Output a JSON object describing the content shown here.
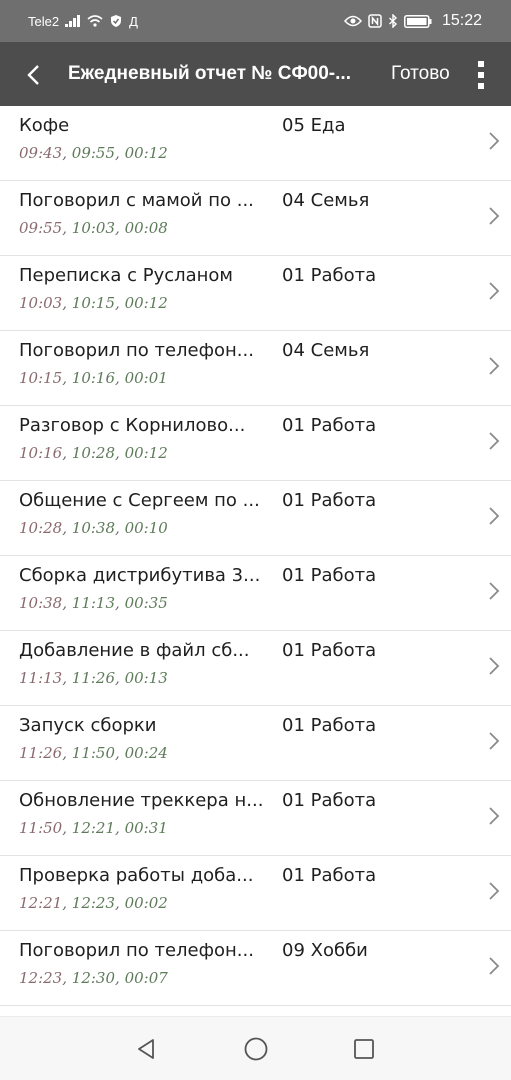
{
  "status_bar": {
    "carrier": "Tele2",
    "extra": "Д",
    "time": "15:22"
  },
  "app_bar": {
    "title": "Ежедневный отчет  № СФ00-...",
    "done_label": "Готово"
  },
  "rows": [
    {
      "name": "Кофе",
      "category": "05 Еда",
      "start": "09:43",
      "end": "09:55",
      "duration": "00:12"
    },
    {
      "name": "Поговорил с мамой по ...",
      "category": "04 Семья",
      "start": "09:55",
      "end": "10:03",
      "duration": "00:08"
    },
    {
      "name": "Переписка с Русланом",
      "category": "01 Работа",
      "start": "10:03",
      "end": "10:15",
      "duration": "00:12"
    },
    {
      "name": "Поговорил по телефон...",
      "category": "04 Семья",
      "start": "10:15",
      "end": "10:16",
      "duration": "00:01"
    },
    {
      "name": "Разговор с Корнилово...",
      "category": "01 Работа",
      "start": "10:16",
      "end": "10:28",
      "duration": "00:12"
    },
    {
      "name": "Общение с Сергеем по ...",
      "category": "01 Работа",
      "start": "10:28",
      "end": "10:38",
      "duration": "00:10"
    },
    {
      "name": "Сборка дистрибутива 3...",
      "category": "01 Работа",
      "start": "10:38",
      "end": "11:13",
      "duration": "00:35"
    },
    {
      "name": "Добавление в файл сб...",
      "category": "01 Работа",
      "start": "11:13",
      "end": "11:26",
      "duration": "00:13"
    },
    {
      "name": "Запуск сборки",
      "category": "01 Работа",
      "start": "11:26",
      "end": "11:50",
      "duration": "00:24"
    },
    {
      "name": "Обновление треккера н...",
      "category": "01 Работа",
      "start": "11:50",
      "end": "12:21",
      "duration": "00:31"
    },
    {
      "name": "Проверка работы доба...",
      "category": "01 Работа",
      "start": "12:21",
      "end": "12:23",
      "duration": "00:02"
    },
    {
      "name": "Поговорил по телефон...",
      "category": "09 Хобби",
      "start": "12:23",
      "end": "12:30",
      "duration": "00:07"
    }
  ],
  "colors": {
    "status_bar_bg": "#6f6f6f",
    "app_bar_bg": "#4d4d4d",
    "time_start": "#8a6a6e",
    "time_end": "#5e7b5a"
  },
  "icons": {
    "back": "chevron-left-icon",
    "menu": "more-vertical-icon",
    "row_arrow": "chevron-right-icon",
    "nav_back": "triangle-back-icon",
    "nav_home": "circle-home-icon",
    "nav_recent": "square-recents-icon"
  }
}
